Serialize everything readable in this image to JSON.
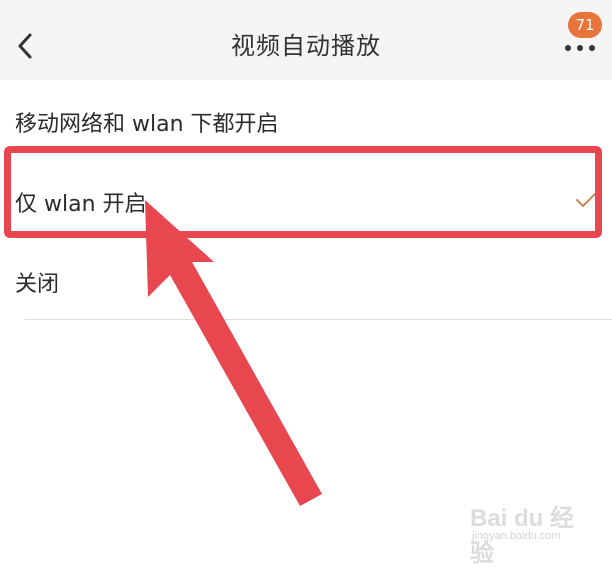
{
  "header": {
    "title": "视频自动播放",
    "badge_count": "71",
    "back_icon": "chevron-left-icon",
    "more_icon": "more-dots-icon"
  },
  "options": [
    {
      "label": "移动网络和 wlan 下都开启",
      "selected": false
    },
    {
      "label": "仅 wlan 开启",
      "selected": true
    },
    {
      "label": "关闭",
      "selected": false
    }
  ],
  "colors": {
    "accent": "#e9743b",
    "check": "#c8885a",
    "annotation": "#e8474f"
  },
  "watermark": {
    "main": "Bai du 经验",
    "sub": "jingyan.baidu.com"
  }
}
